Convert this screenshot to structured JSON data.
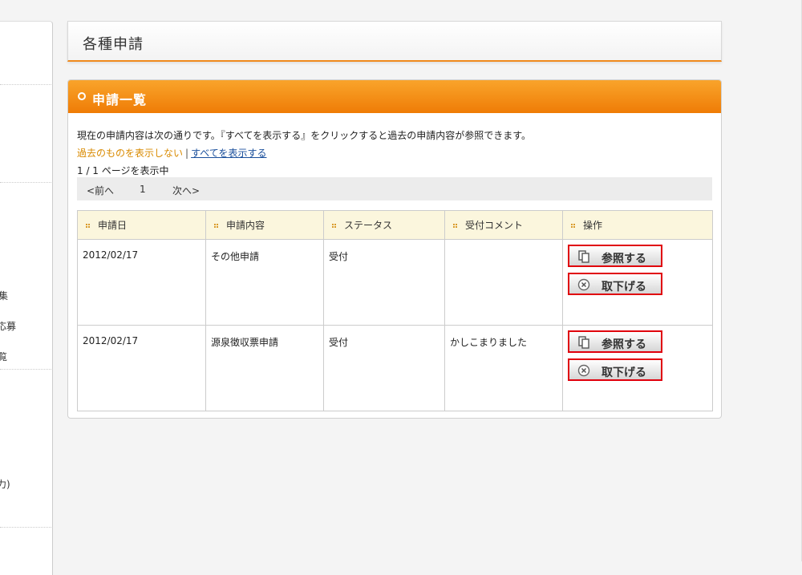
{
  "sidebar": {
    "fragments": [
      "集",
      "応募",
      "覧",
      "力)"
    ]
  },
  "header": {
    "title": "各種申請"
  },
  "panel": {
    "title": "申請一覧",
    "description": "現在の申請内容は次の通りです。『すべてを表示する』をクリックすると過去の申請内容が参照できます。",
    "hide_past_link": "過去のものを表示しない",
    "link_separator": "|",
    "show_all_link": "すべてを表示する",
    "page_info": "1 / 1 ページを表示中",
    "pager": {
      "prev": "<前へ",
      "current": "1",
      "next": "次へ>"
    }
  },
  "table": {
    "headers": [
      "申請日",
      "申請内容",
      "ステータス",
      "受付コメント",
      "操作"
    ],
    "rows": [
      {
        "date": "2012/02/17",
        "content": "その他申請",
        "status": "受付",
        "comment": ""
      },
      {
        "date": "2012/02/17",
        "content": "源泉徴収票申請",
        "status": "受付",
        "comment": "かしこまりました"
      }
    ],
    "view_button": "参照する",
    "withdraw_button": "取下げる",
    "icons": {
      "view": "copy-document-icon",
      "withdraw": "close-circle-icon"
    }
  },
  "colors": {
    "accent": "#ef7c06",
    "button_border": "#e0000c",
    "header_bg": "#fbf6dd",
    "link": "#1a4f9c",
    "muted_link": "#d98a00"
  }
}
